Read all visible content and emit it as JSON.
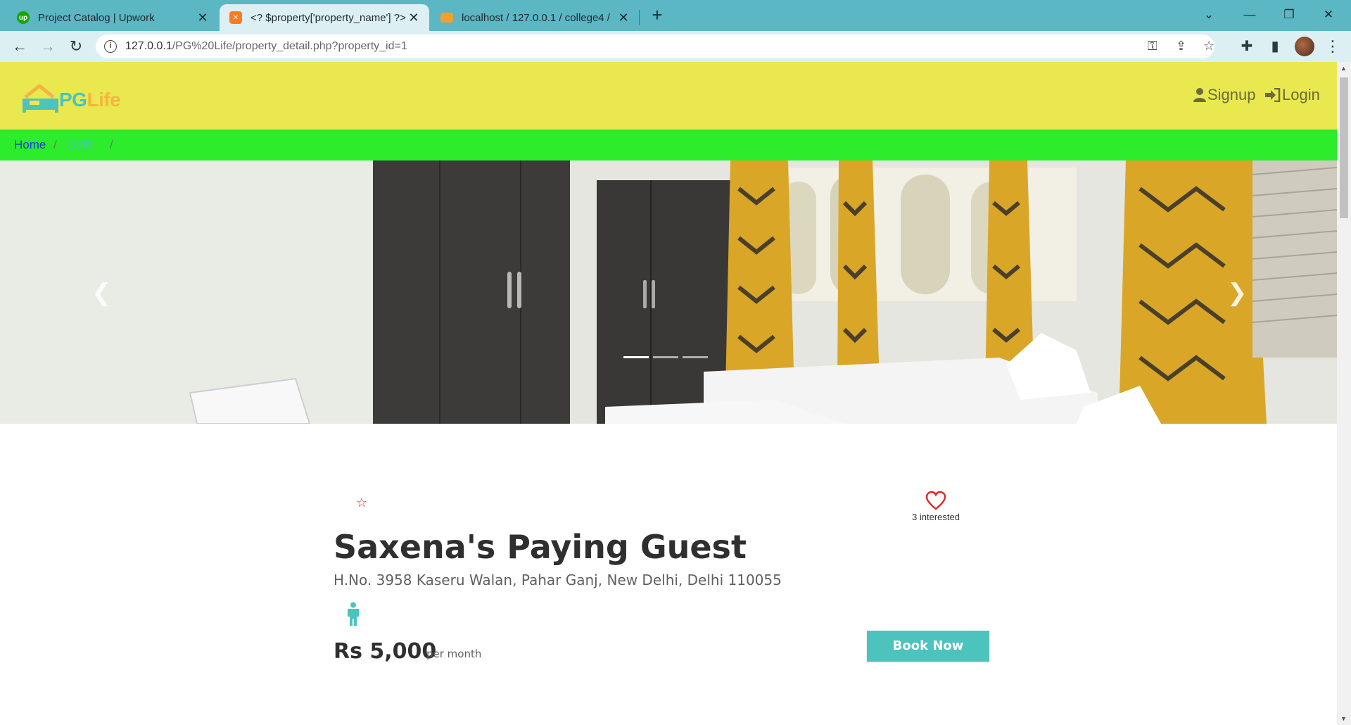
{
  "browser": {
    "tabs": [
      {
        "title": "Project Catalog | Upwork",
        "icon": "upwork-icon",
        "color": "#14a800"
      },
      {
        "title": "<? $property['property_name'] ?>",
        "icon": "xampp-icon",
        "color": "#fb7a24"
      },
      {
        "title": "localhost / 127.0.0.1 / college4 / ",
        "icon": "phpmyadmin-icon",
        "color": "#f0a030"
      }
    ],
    "url_host": "127.0.0.1",
    "url_path": "/PG%20Life/property_detail.php?property_id=1"
  },
  "header": {
    "logo_pg": "PG",
    "logo_life": "Life",
    "signup_label": "Signup",
    "login_label": "Login"
  },
  "breadcrumb": {
    "home": "Home",
    "city": "Delhi"
  },
  "property": {
    "name": "Saxena's Paying Guest",
    "address": "H.No. 3958 Kaseru Walan, Pahar Ganj, New Delhi, Delhi 110055",
    "interested": "3 interested",
    "rent": "Rs 5,000",
    "rent_unit": "per month",
    "book_label": "Book Now",
    "rating_icon": "star-outline-icon",
    "gender_icon": "male-icon"
  },
  "colors": {
    "header_bg": "#e9e94f",
    "breadcrumb_bg": "#2cec2c",
    "accent": "#4cc3bd",
    "favorite": "#e02424",
    "tabbar": "#5ab7c3"
  }
}
